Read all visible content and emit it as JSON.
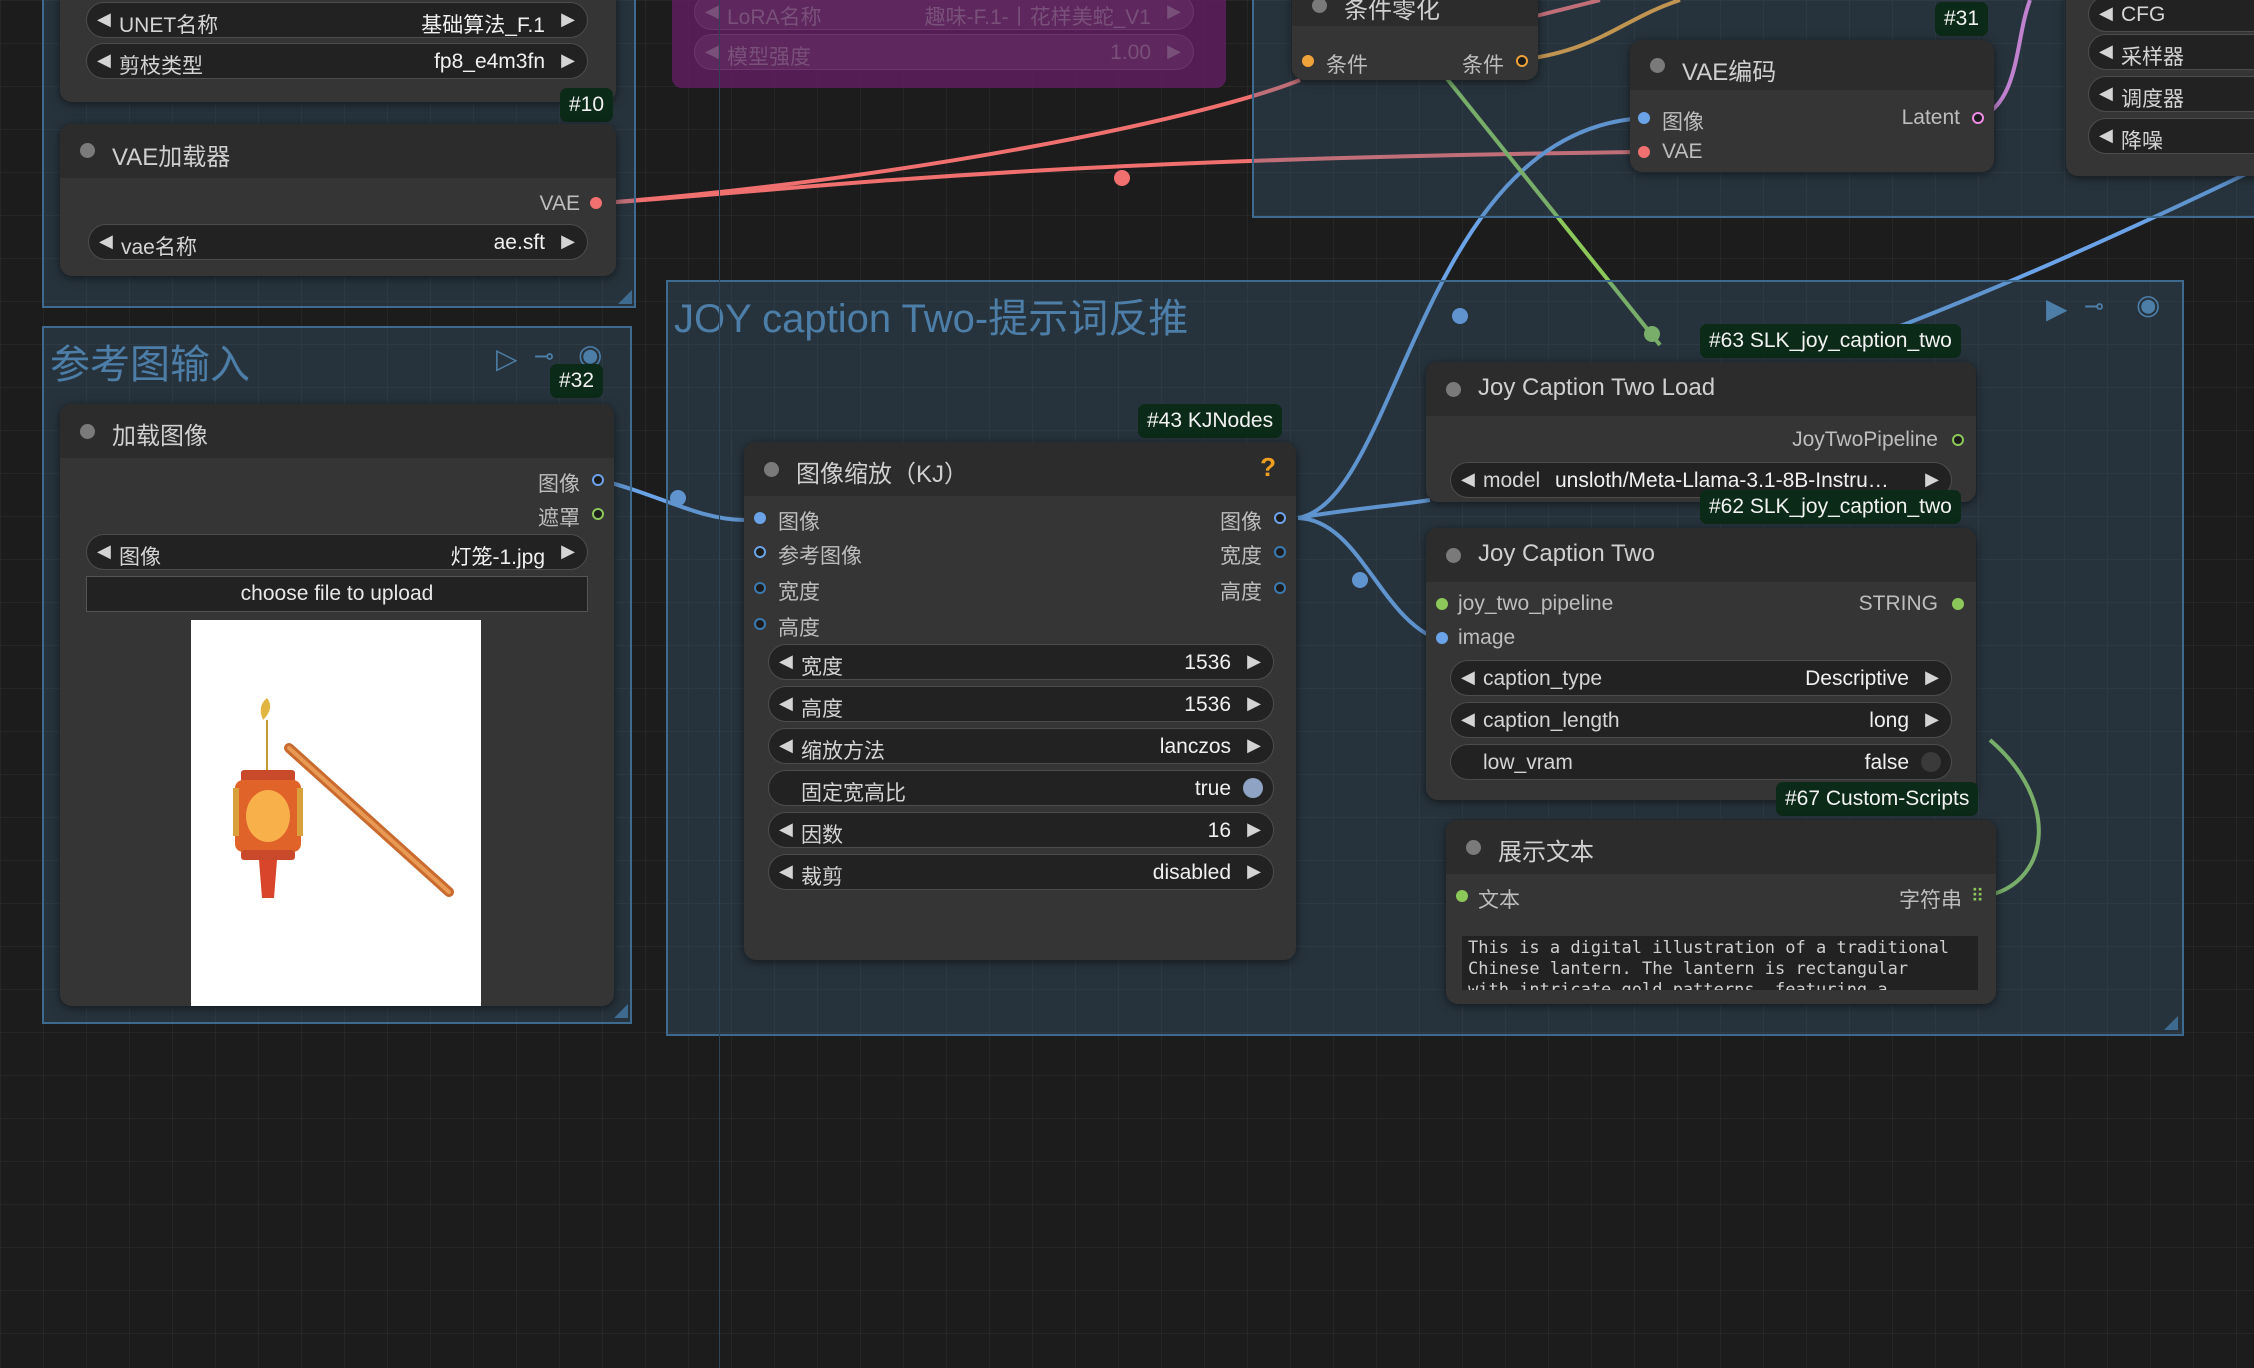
{
  "colors": {
    "image": "#6ba3e8",
    "vae": "#f07070",
    "latent": "#f08ae8",
    "conditioning": "#f0a23a",
    "mask": "#8cc75a",
    "string": "#9bd35a",
    "group_blue": "#456e91",
    "group_purple": "#7a2a7a"
  },
  "groups": {
    "ref_input_title": "参考图输入",
    "joy_title": "JOY caption Two-提示词反推"
  },
  "lora_node": {
    "lora_label": "LoRA名称",
    "lora_value": "趣味-F.1-丨花样美蛇_V1",
    "strength_label": "模型强度",
    "strength_value": "1.00"
  },
  "unet_node": {
    "badge": "#10",
    "unet_label": "UNET名称",
    "unet_value": "基础算法_F.1",
    "clip_label": "剪枝类型",
    "clip_value": "fp8_e4m3fn"
  },
  "vae_loader": {
    "title": "VAE加载器",
    "output": "VAE",
    "vae_label": "vae名称",
    "vae_value": "ae.sft"
  },
  "cond_zero": {
    "title": "条件零化",
    "input": "条件",
    "output": "条件"
  },
  "vae_encode": {
    "badge": "#31",
    "title": "VAE编码",
    "in_image": "图像",
    "in_vae": "VAE",
    "out_latent": "Latent"
  },
  "sampler_panel": {
    "items": [
      "CFG",
      "采样器",
      "调度器",
      "降噪"
    ]
  },
  "load_image": {
    "badge": "#32",
    "title": "加载图像",
    "out_image": "图像",
    "out_mask": "遮罩",
    "image_label": "图像",
    "image_value": "灯笼-1.jpg",
    "upload_button": "choose file to upload"
  },
  "resize_node": {
    "badge": "#43 KJNodes",
    "title": "图像缩放（KJ）",
    "help": "?",
    "inputs": [
      "图像",
      "参考图像",
      "宽度",
      "高度"
    ],
    "outputs": [
      "图像",
      "宽度",
      "高度"
    ],
    "width_label": "宽度",
    "width_value": "1536",
    "height_label": "高度",
    "height_value": "1536",
    "method_label": "缩放方法",
    "method_value": "lanczos",
    "keep_label": "固定宽高比",
    "keep_value": "true",
    "factor_label": "因数",
    "factor_value": "16",
    "crop_label": "裁剪",
    "crop_value": "disabled"
  },
  "joy_load": {
    "badge": "#63 SLK_joy_caption_two",
    "title": "Joy Caption Two Load",
    "output": "JoyTwoPipeline",
    "model_label": "model",
    "model_value": "unsloth/Meta-Llama-3.1-8B-Instru…"
  },
  "joy_caption": {
    "badge": "#62 SLK_joy_caption_two",
    "title": "Joy Caption Two",
    "in_pipeline": "joy_two_pipeline",
    "in_image": "image",
    "output": "STRING",
    "type_label": "caption_type",
    "type_value": "Descriptive",
    "length_label": "caption_length",
    "length_value": "long",
    "vram_label": "low_vram",
    "vram_value": "false"
  },
  "show_text": {
    "badge": "#67 Custom-Scripts",
    "title": "展示文本",
    "input": "文本",
    "output": "字符串",
    "text_line1": "This is a digital illustration of a traditional",
    "text_line2": "Chinese lantern. The lantern is rectangular",
    "text_line3": "with intricate gold patterns, featuring a"
  }
}
